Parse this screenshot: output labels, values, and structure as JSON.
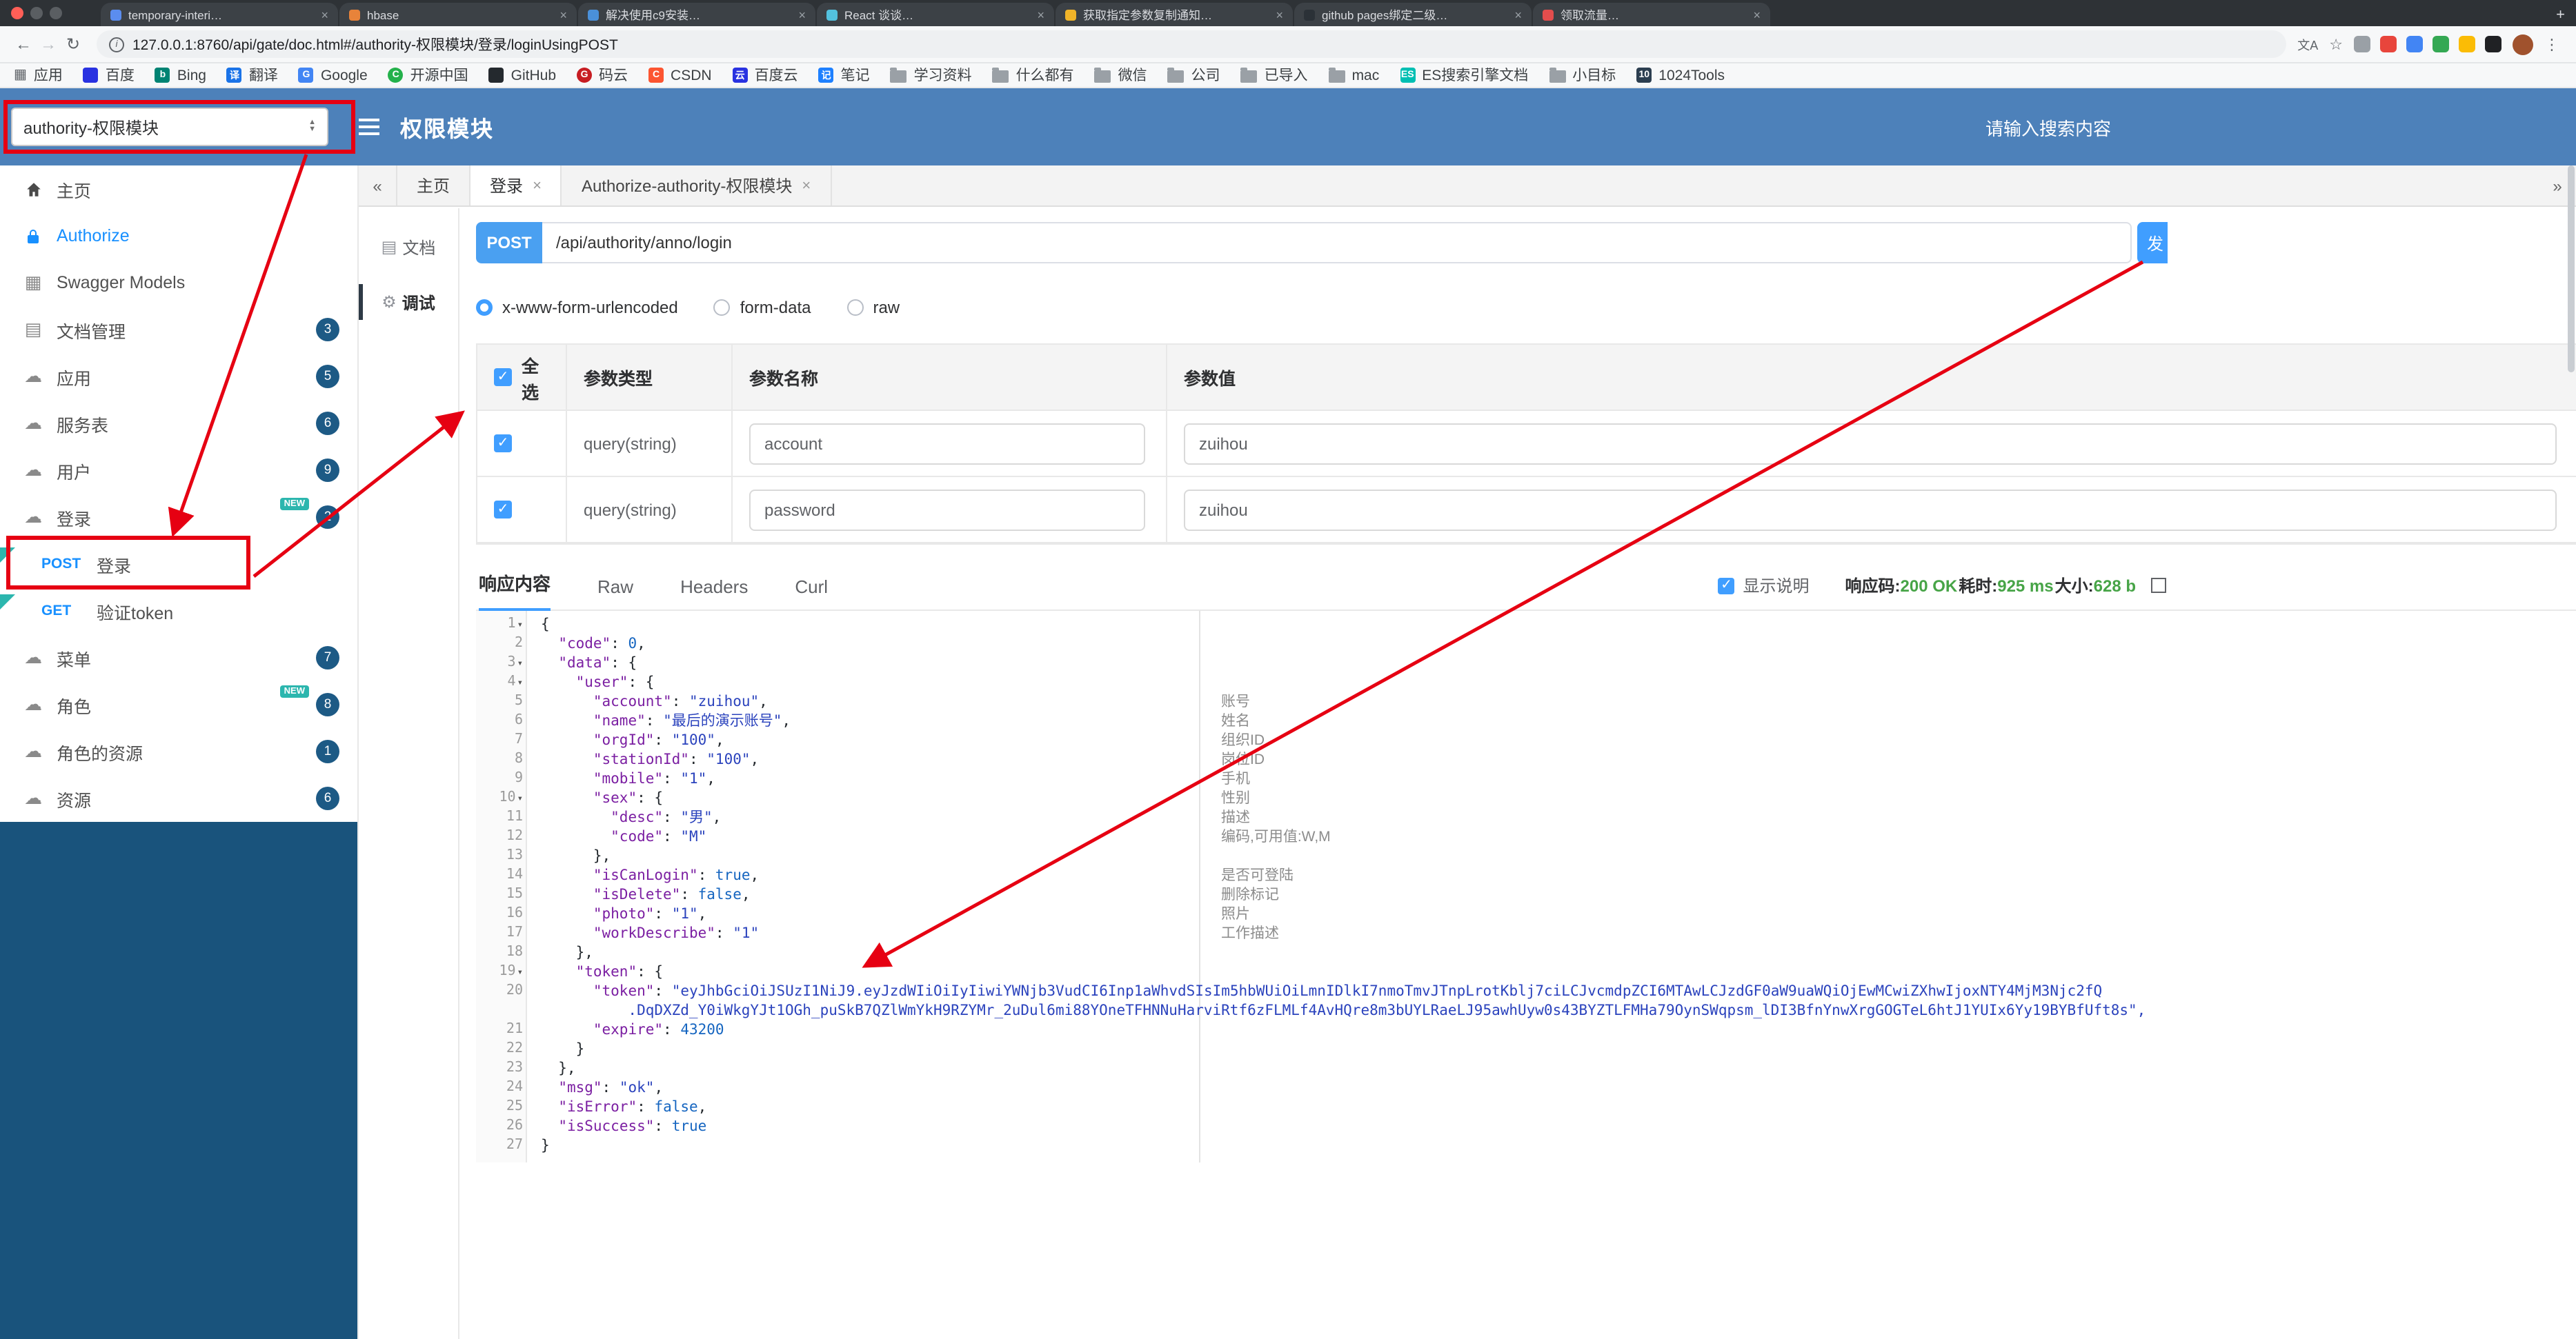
{
  "colors": {
    "header_blue": "#4D81BA",
    "sidebar_fill_blue": "#19537C",
    "badge_blue": "#1D5A85",
    "accent_blue": "#409EFF",
    "success_green": "#47A447",
    "annotation_red": "#E60012",
    "new_teal": "#2CB6AE"
  },
  "browser": {
    "window_controls": {
      "close": "#FF5F57",
      "minimize": "#5A5E62",
      "maximize": "#5A5E62"
    },
    "tabs": [
      {
        "label": "temporary-interi…",
        "favicon_color": "#5B8DEF"
      },
      {
        "label": "hbase",
        "favicon_color": "#E8833A"
      },
      {
        "label": "解决使用c9安装…",
        "favicon_color": "#4A90D9"
      },
      {
        "label": "React 谈谈…",
        "favicon_color": "#53C1DE"
      },
      {
        "label": "获取指定参数复制通知…",
        "favicon_color": "#F0B429"
      },
      {
        "label": "github pages绑定二级…",
        "favicon_color": "#2B3137"
      },
      {
        "label": "领取流量…",
        "favicon_color": "#E34D4D"
      }
    ],
    "new_tab_label": "+",
    "nav": {
      "back": "←",
      "forward": "→",
      "reload": "↻"
    },
    "url": "127.0.0.1:8760/api/gate/doc.html#/authority-权限模块/登录/loginUsingPOST",
    "toolbar_icons": {
      "translate": "文A",
      "star": "☆",
      "menu": "⋮"
    },
    "extension_colors": [
      "#9AA0A6",
      "#E8453C",
      "#4285F4",
      "#34A853",
      "#FBBC05",
      "#202124"
    ],
    "bookmarks": [
      {
        "label": "应用",
        "icon": "apps"
      },
      {
        "label": "百度",
        "icon": "dot",
        "color": "#2932E1"
      },
      {
        "label": "Bing",
        "icon": "letter",
        "glyph": "b",
        "color": "#008373"
      },
      {
        "label": "翻译",
        "icon": "letter",
        "glyph": "译",
        "color": "#1A73E8"
      },
      {
        "label": "Google",
        "icon": "letter",
        "glyph": "G",
        "color": "#4285F4"
      },
      {
        "label": "开源中国",
        "icon": "letter",
        "glyph": "C",
        "color": "#24B14B",
        "shape": "circle"
      },
      {
        "label": "GitHub",
        "icon": "dot",
        "color": "#24292E"
      },
      {
        "label": "码云",
        "icon": "letter",
        "glyph": "G",
        "color": "#C71D23",
        "shape": "circle"
      },
      {
        "label": "CSDN",
        "icon": "letter",
        "glyph": "C",
        "color": "#FC5531"
      },
      {
        "label": "百度云",
        "icon": "letter",
        "glyph": "云",
        "color": "#2932E1"
      },
      {
        "label": "笔记",
        "icon": "letter",
        "glyph": "记",
        "color": "#1E80FF"
      },
      {
        "label": "学习资料",
        "icon": "folder"
      },
      {
        "label": "什么都有",
        "icon": "folder"
      },
      {
        "label": "微信",
        "icon": "folder"
      },
      {
        "label": "公司",
        "icon": "folder"
      },
      {
        "label": "已导入",
        "icon": "folder"
      },
      {
        "label": "mac",
        "icon": "folder"
      },
      {
        "label": "ES搜索引擎文档",
        "icon": "letter",
        "glyph": "ES",
        "color": "#00BFB3"
      },
      {
        "label": "小目标",
        "icon": "folder"
      },
      {
        "label": "1024Tools",
        "icon": "letter",
        "glyph": "10",
        "color": "#2C3E50"
      }
    ]
  },
  "header": {
    "module_select_value": "authority-权限模块",
    "title": "权限模块",
    "search_placeholder": "请输入搜索内容"
  },
  "sidebar": {
    "items": [
      {
        "id": "home",
        "label": "主页",
        "icon": "home"
      },
      {
        "id": "authorize",
        "label": "Authorize",
        "icon": "lock",
        "active": true
      },
      {
        "id": "swagger-models",
        "label": "Swagger Models",
        "icon": "grid"
      },
      {
        "id": "doc-manage",
        "label": "文档管理",
        "icon": "doc",
        "badge": "3"
      },
      {
        "id": "app",
        "label": "应用",
        "icon": "cloud",
        "badge": "5"
      },
      {
        "id": "service-table",
        "label": "服务表",
        "icon": "cloud",
        "badge": "6"
      },
      {
        "id": "user",
        "label": "用户",
        "icon": "cloud",
        "badge": "9"
      },
      {
        "id": "login",
        "label": "登录",
        "icon": "cloud",
        "badge": "2",
        "new": true
      },
      {
        "id": "login-post",
        "label": "登录",
        "method": "POST",
        "child": true,
        "flag": true,
        "highlighted": true
      },
      {
        "id": "verify-token-get",
        "label": "验证token",
        "method": "GET",
        "child": true,
        "flag": true
      },
      {
        "id": "menu",
        "label": "菜单",
        "icon": "cloud",
        "badge": "7"
      },
      {
        "id": "role",
        "label": "角色",
        "icon": "cloud",
        "badge": "8",
        "new": true
      },
      {
        "id": "role-resource",
        "label": "角色的资源",
        "icon": "cloud",
        "badge": "1"
      },
      {
        "id": "resource",
        "label": "资源",
        "icon": "cloud",
        "badge": "6"
      }
    ]
  },
  "tabbar": {
    "left_chevron": "«",
    "right_chevron": "»",
    "tabs": [
      {
        "label": "主页"
      },
      {
        "label": "登录",
        "closable": true,
        "active": true
      },
      {
        "label": "Authorize-authority-权限模块",
        "closable": true
      }
    ]
  },
  "doc_tabs": [
    {
      "label": "文档"
    },
    {
      "label": "调试",
      "active": true
    }
  ],
  "request": {
    "method": "POST",
    "path": "/api/authority/anno/login",
    "send_button_label": "发",
    "content_types": [
      {
        "label": "x-www-form-urlencoded",
        "selected": true
      },
      {
        "label": "form-data",
        "selected": false
      },
      {
        "label": "raw",
        "selected": false
      }
    ],
    "params_table": {
      "headers": [
        "全选",
        "参数类型",
        "参数名称",
        "参数值"
      ],
      "select_all_checked": true,
      "rows": [
        {
          "checked": true,
          "type": "query(string)",
          "name": "account",
          "value": "zuihou"
        },
        {
          "checked": true,
          "type": "query(string)",
          "name": "password",
          "value": "zuihou"
        }
      ]
    }
  },
  "response": {
    "tabs": [
      {
        "label": "响应内容",
        "active": true
      },
      {
        "label": "Raw"
      },
      {
        "label": "Headers"
      },
      {
        "label": "Curl"
      }
    ],
    "show_description_label": "显示说明",
    "show_description_checked": true,
    "meta": [
      {
        "label": "响应码:",
        "value": "200 OK"
      },
      {
        "label": "耗时:",
        "value": "925 ms"
      },
      {
        "label": "大小:",
        "value": "628 b"
      }
    ],
    "code_lines": [
      {
        "n": 1,
        "t": "{",
        "fold": true
      },
      {
        "n": 2,
        "t": "  \"code\": 0,"
      },
      {
        "n": 3,
        "t": "  \"data\": {",
        "fold": true
      },
      {
        "n": 4,
        "t": "    \"user\": {",
        "fold": true
      },
      {
        "n": 5,
        "t": "      \"account\": \"zuihou\","
      },
      {
        "n": 6,
        "t": "      \"name\": \"最后的演示账号\","
      },
      {
        "n": 7,
        "t": "      \"orgId\": \"100\","
      },
      {
        "n": 8,
        "t": "      \"stationId\": \"100\","
      },
      {
        "n": 9,
        "t": "      \"mobile\": \"1\","
      },
      {
        "n": 10,
        "t": "      \"sex\": {",
        "fold": true
      },
      {
        "n": 11,
        "t": "        \"desc\": \"男\","
      },
      {
        "n": 12,
        "t": "        \"code\": \"M\""
      },
      {
        "n": 13,
        "t": "      },"
      },
      {
        "n": 14,
        "t": "      \"isCanLogin\": true,"
      },
      {
        "n": 15,
        "t": "      \"isDelete\": false,"
      },
      {
        "n": 16,
        "t": "      \"photo\": \"1\","
      },
      {
        "n": 17,
        "t": "      \"workDescribe\": \"1\""
      },
      {
        "n": 18,
        "t": "    },"
      },
      {
        "n": 19,
        "t": "    \"token\": {",
        "fold": true
      },
      {
        "n": 20,
        "t": "      \"token\": \"eyJhbGciOiJSUzI1NiJ9.eyJzdWIiOiIyIiwiYWNjb3VudCI6Inp1aWhvdSIsIm5hbWUiOiLmnIDlkI7nmoTmvJTnpLrotKblj7ciLCJvcmdpZCI6MTAwLCJzdGF0aW9uaWQiOjEwMCwiZXhwIjoxNTY4MjM3Njc2fQ",
        "t2": "          .DqDXZd_Y0iWkgYJt1OGh_puSkB7QZlWmYkH9RZYMr_2uDul6mi88YOneTFHNNuHarviRtf6zFLMLf4AvHQre8m3bUYLRaeLJ95awhUyw0s43BYZTLFMHa79OynSWqpsm_lDI3BfnYnwXrgGOGTeL6htJ1YUIx6Yy19BYBfUft8s\","
      },
      {
        "n": 21,
        "t": "      \"expire\": 43200"
      },
      {
        "n": 22,
        "t": "    }"
      },
      {
        "n": 23,
        "t": "  },"
      },
      {
        "n": 24,
        "t": "  \"msg\": \"ok\","
      },
      {
        "n": 25,
        "t": "  \"isError\": false,"
      },
      {
        "n": 26,
        "t": "  \"isSuccess\": true"
      },
      {
        "n": 27,
        "t": "}"
      }
    ],
    "annotations": [
      {
        "line": 5,
        "text": "账号"
      },
      {
        "line": 6,
        "text": "姓名"
      },
      {
        "line": 7,
        "text": "组织ID"
      },
      {
        "line": 8,
        "text": "岗位ID"
      },
      {
        "line": 9,
        "text": "手机"
      },
      {
        "line": 10,
        "text": "性别"
      },
      {
        "line": 11,
        "text": "描述"
      },
      {
        "line": 12,
        "text": "编码,可用值:W,M"
      },
      {
        "line": 14,
        "text": "是否可登陆"
      },
      {
        "line": 15,
        "text": "删除标记"
      },
      {
        "line": 16,
        "text": "照片"
      },
      {
        "line": 17,
        "text": "工作描述"
      }
    ]
  }
}
